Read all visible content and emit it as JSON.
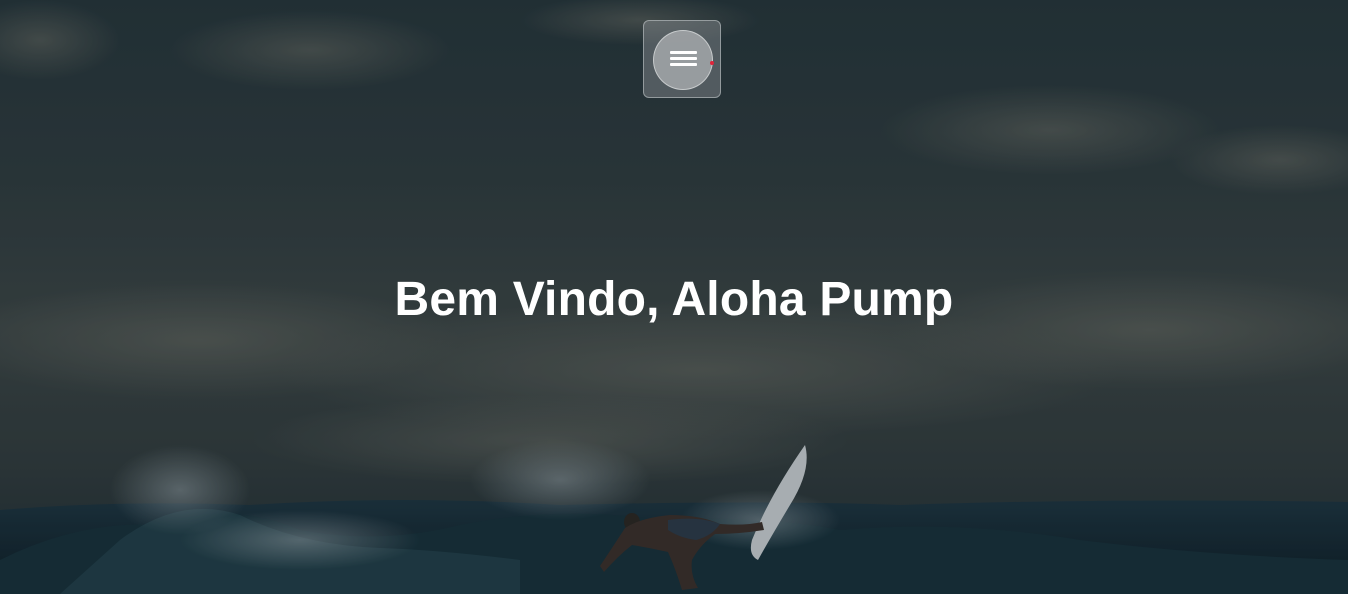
{
  "hero": {
    "headline": "Bem Vindo, Aloha Pump",
    "background_image": "surfer-on-wave-photo"
  },
  "menu": {
    "icon": "hamburger-menu-icon",
    "notification_color": "#e0243a"
  },
  "colors": {
    "headline": "#ffffff",
    "overlay": "#0f161a"
  }
}
